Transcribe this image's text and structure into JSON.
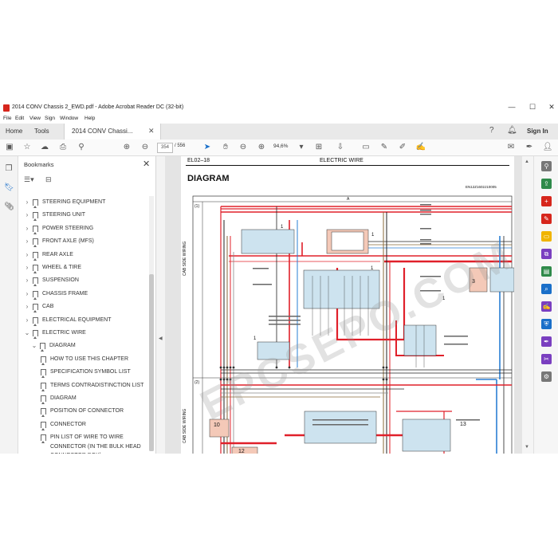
{
  "window": {
    "title": "2014 CONV Chassis 2_EWD.pdf - Adobe Acrobat Reader DC (32-bit)",
    "controls": [
      "—",
      "☐",
      "✕"
    ]
  },
  "menu": [
    "File",
    "Edit",
    "View",
    "Sign",
    "Window",
    "Help"
  ],
  "tabs": {
    "home": "Home",
    "tools": "Tools",
    "document": "2014 CONV Chassi...",
    "signin": "Sign In"
  },
  "toolbar": {
    "page_current": "354",
    "page_total": "/ 556",
    "zoom": "94,6%"
  },
  "bookmarks": {
    "header": "Bookmarks",
    "items": [
      {
        "label": "STEERING EQUIPMENT",
        "level": 0,
        "expanded": false
      },
      {
        "label": "STEERING UNIT",
        "level": 0,
        "expanded": false
      },
      {
        "label": "POWER STEERING",
        "level": 0,
        "expanded": false
      },
      {
        "label": "FRONT AXLE (MFS)",
        "level": 0,
        "expanded": false
      },
      {
        "label": "REAR AXLE",
        "level": 0,
        "expanded": false
      },
      {
        "label": "WHEEL & TIRE",
        "level": 0,
        "expanded": false
      },
      {
        "label": "SUSPENSION",
        "level": 0,
        "expanded": false
      },
      {
        "label": "CHASSIS FRAME",
        "level": 0,
        "expanded": false
      },
      {
        "label": "CAB",
        "level": 0,
        "expanded": false
      },
      {
        "label": "ELECTRICAL EQUIPMENT",
        "level": 0,
        "expanded": false
      },
      {
        "label": "ELECTRIC WIRE",
        "level": 0,
        "expanded": true
      },
      {
        "label": "DIAGRAM",
        "level": 1,
        "expanded": true
      },
      {
        "label": "HOW TO USE THIS CHAPTER",
        "level": 2,
        "expanded": false
      },
      {
        "label": "SPECIFICATION SYMBOL LIST",
        "level": 2,
        "expanded": false
      },
      {
        "label": "TERMS CONTRADISTINCTION LIST",
        "level": 2,
        "expanded": false
      },
      {
        "label": "DIAGRAM",
        "level": 2,
        "expanded": false
      },
      {
        "label": "POSITION OF CONNECTOR",
        "level": 2,
        "expanded": false
      },
      {
        "label": "CONNECTOR",
        "level": 2,
        "expanded": false
      },
      {
        "label": "PIN LIST OF WIRE TO WIRE",
        "level": 2,
        "expanded": false
      },
      {
        "label": "CONNECTOR (IN THE BULK HEAD",
        "level": 2,
        "expanded": false
      },
      {
        "label": "CONNECTOR BOX)",
        "level": 2,
        "expanded": false
      }
    ]
  },
  "document": {
    "page_code": "EL02–18",
    "section": "ELECTRIC WIRE",
    "heading": "DIAGRAM",
    "ref": "EN12Z1602J10005",
    "column_marker": "A",
    "row_markers": [
      "(1)",
      "(2)"
    ],
    "side_labels": [
      "CAB SIDE WIRING",
      "CAB SIDE WIRING"
    ],
    "callouts": [
      "1",
      "1",
      "1",
      "1",
      "1",
      "3",
      "10",
      "12",
      "13"
    ],
    "watermark": "EPCSEPO.COM"
  },
  "colors": {
    "accent": "#d6261c",
    "wire_red": "#e0202a",
    "wire_blue": "#2a7fd4",
    "wire_black": "#222222",
    "connector_fill": "#cde3ef",
    "highlight_fill": "#f4c9b8"
  }
}
